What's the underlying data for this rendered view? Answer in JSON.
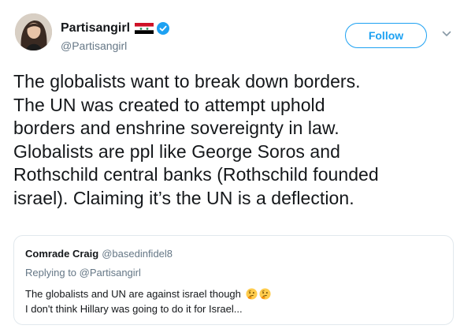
{
  "author": {
    "display_name": "Partisangirl",
    "handle": "@Partisangirl",
    "flag": "syria-flag",
    "verified": true
  },
  "actions": {
    "follow_label": "Follow",
    "more_icon": "chevron-down-icon"
  },
  "tweet": {
    "text": "The globalists want to break down borders.\nThe UN was created to attempt uphold\nborders and enshrine sovereignty in law.\nGlobalists are ppl like George Soros and\nRothschild central banks (Rothschild founded\nisrael). Claiming it’s the UN is a deflection."
  },
  "quoted_tweet": {
    "display_name": "Comrade Craig",
    "handle": "@basedinfidel8",
    "replying_prefix": "Replying to",
    "replying_to": "@Partisangirl",
    "line1": "The globalists and UN are against israel though",
    "line2": "I don't think Hillary was going to do it for Israel...",
    "emojis": [
      "thinking-face-icon",
      "thinking-face-icon"
    ]
  },
  "colors": {
    "accent": "#1da1f2",
    "text": "#14171a",
    "secondary": "#657786",
    "border": "#e1e8ed"
  }
}
